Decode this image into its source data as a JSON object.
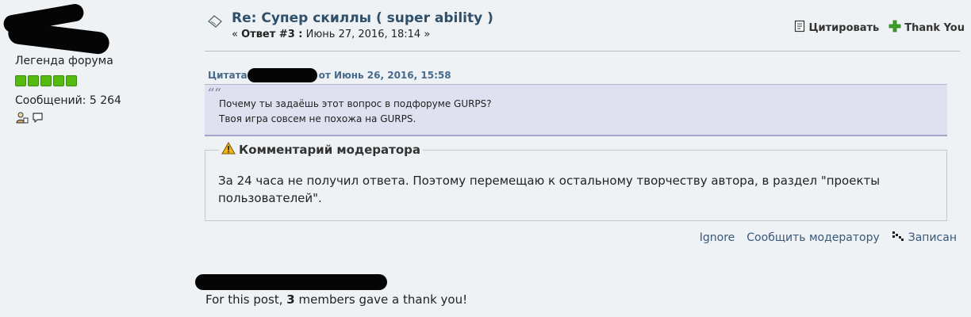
{
  "user": {
    "title": "Легенда форума",
    "rank_stars": 5,
    "post_count_label": "Сообщений:",
    "post_count": "5 264",
    "profile_icon": "profile-icon",
    "pm_icon": "speech-bubble-icon"
  },
  "post": {
    "icon": "post-topic-icon",
    "subject": "Re: Супер скиллы ( super ability )",
    "meta_prefix": "«",
    "reply_label": "Ответ #3 :",
    "date": "Июнь 27, 2016, 18:14",
    "meta_suffix": "»",
    "actions": {
      "quote": "Цитировать",
      "quote_icon": "quote-icon",
      "thank": "Thank You",
      "thank_icon": "plus-icon"
    }
  },
  "quote": {
    "header_prefix": "Цитата",
    "header_suffix": "от Июнь 26, 2016, 15:58",
    "mark": "““",
    "lines": [
      "Почему ты задаёшь этот вопрос в подфоруме GURPS?",
      "Твоя игра совсем не похожа на GURPS."
    ]
  },
  "moderator": {
    "icon": "warning-icon",
    "title": "Комментарий модератора",
    "text": "За 24 часа не получил ответа. Поэтому перемещаю к остальному творчеству автора, в раздел \"проекты пользователей\"."
  },
  "footer": {
    "ignore": "Ignore",
    "report": "Сообщить модератору",
    "logged_icon": "ip-logged-icon",
    "logged": "Записан"
  },
  "thanks": {
    "prefix": "For this post,",
    "count": "3",
    "suffix": "members gave a thank you!"
  },
  "colors": {
    "background": "#eef2f4",
    "subject": "#2f4f6a",
    "quote_bg": "#dfe0f0",
    "link": "#3a5877",
    "rank_star": "#55bb11",
    "thank_plus": "#3aa02a"
  }
}
